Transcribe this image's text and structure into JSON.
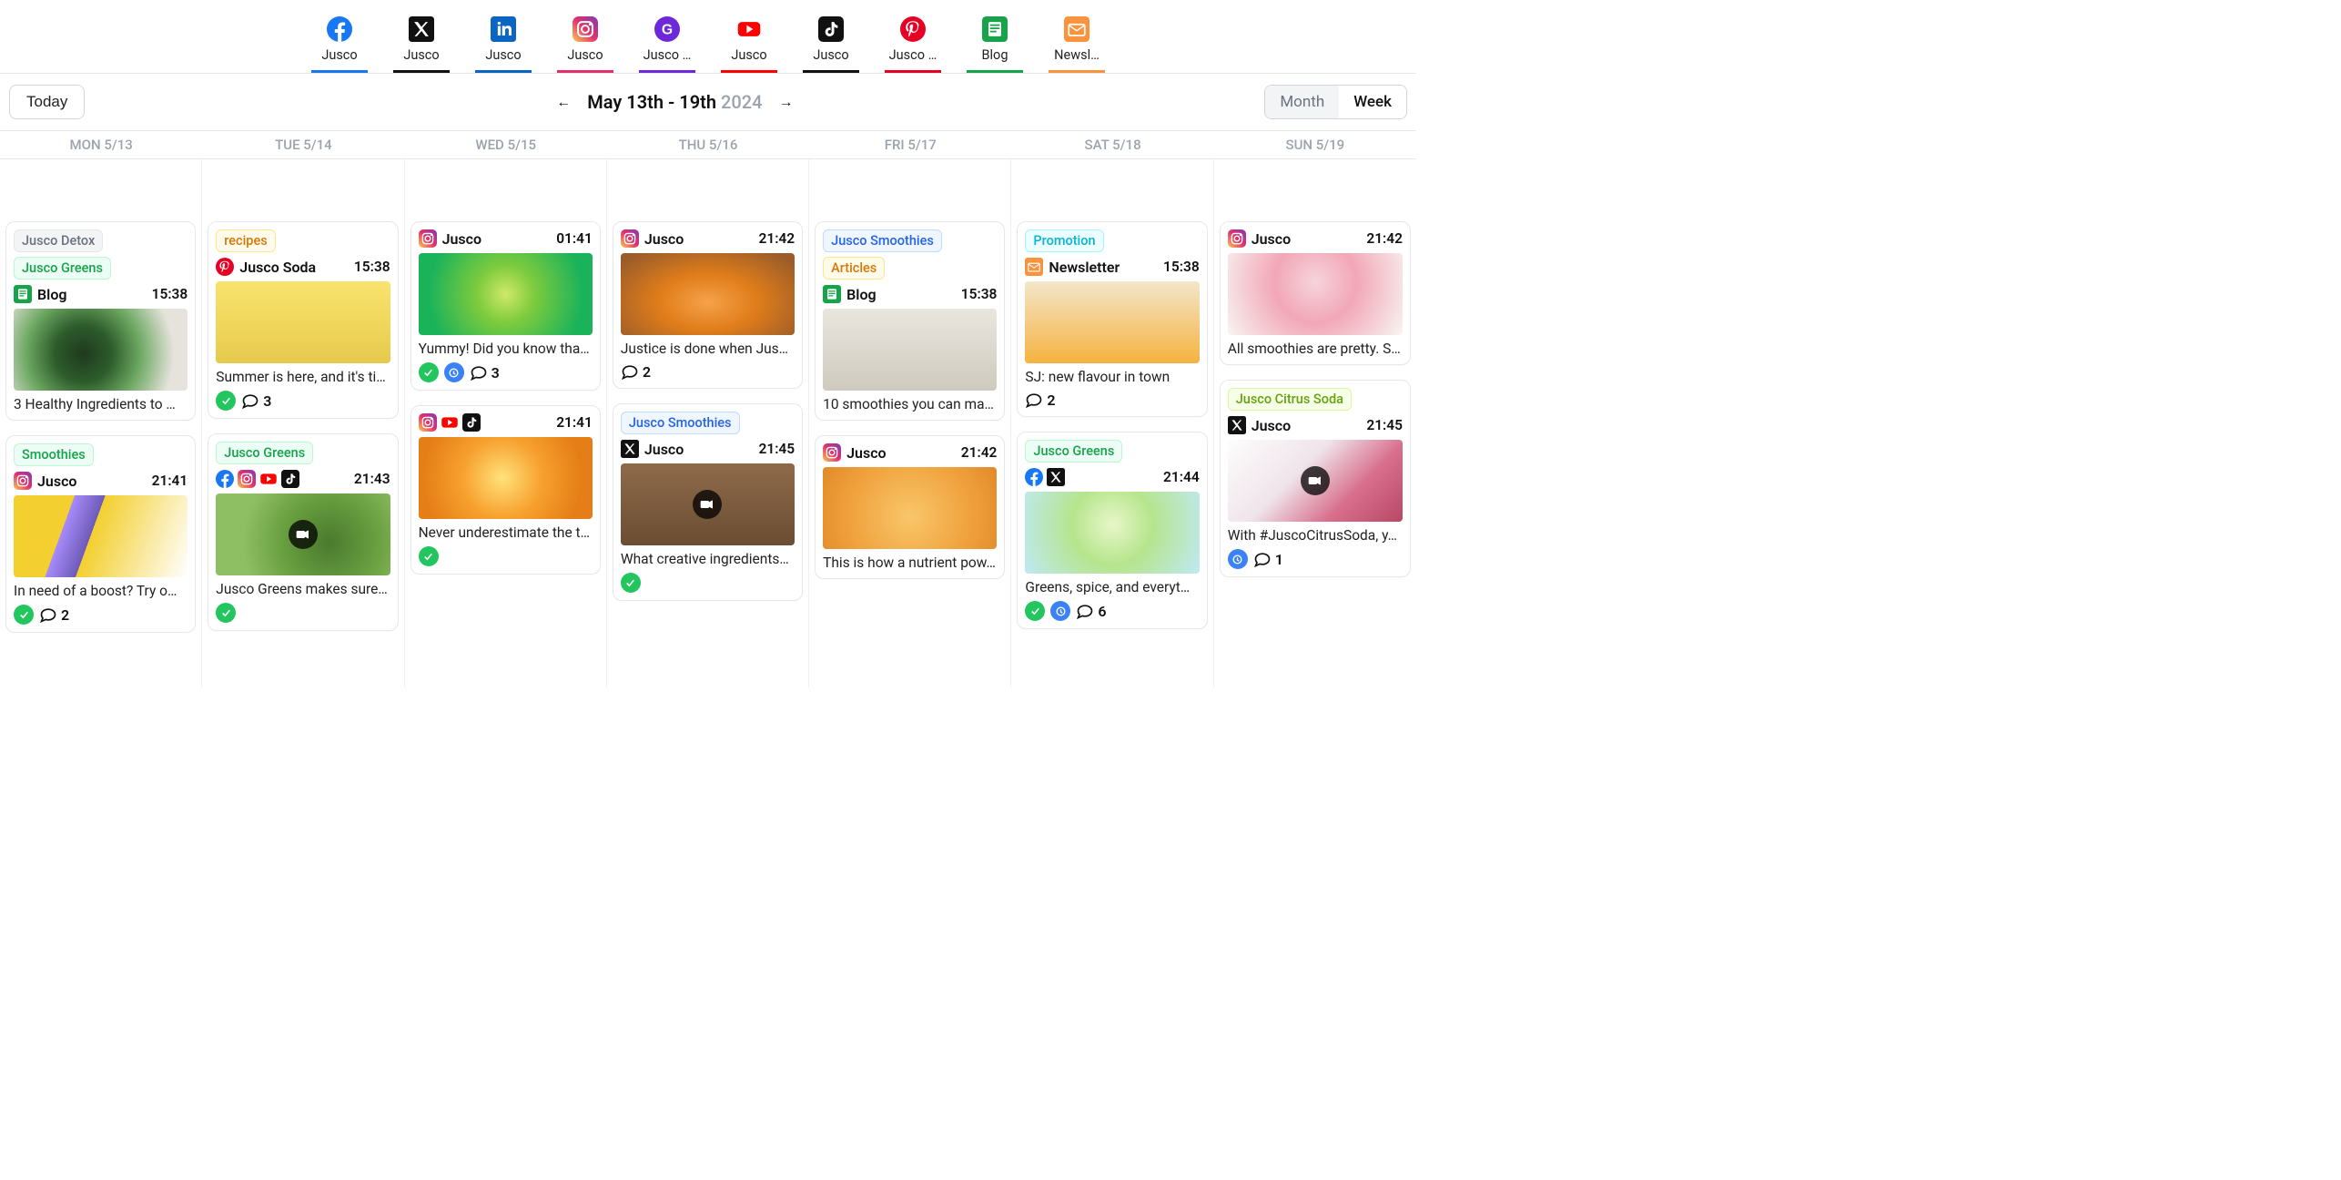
{
  "channels": [
    {
      "label": "Jusco",
      "net": "facebook",
      "bar": "#1877F2"
    },
    {
      "label": "Jusco",
      "net": "x",
      "bar": "#111111"
    },
    {
      "label": "Jusco",
      "net": "linkedin",
      "bar": "#0A66C2"
    },
    {
      "label": "Jusco",
      "net": "instagram",
      "bar": "#E1306C"
    },
    {
      "label": "Jusco …",
      "net": "google",
      "bar": "#6D28D9"
    },
    {
      "label": "Jusco",
      "net": "youtube",
      "bar": "#FF0000"
    },
    {
      "label": "Jusco",
      "net": "tiktok",
      "bar": "#111111"
    },
    {
      "label": "Jusco …",
      "net": "pinterest",
      "bar": "#E60023"
    },
    {
      "label": "Blog",
      "net": "blog",
      "bar": "#16A34A"
    },
    {
      "label": "Newsl…",
      "net": "newsletter",
      "bar": "#FB923C"
    }
  ],
  "toolbar": {
    "today": "Today",
    "range_bold": "May 13th - 19th",
    "range_year": "2024",
    "month": "Month",
    "week": "Week"
  },
  "day_headers": [
    "MON 5/13",
    "TUE 5/14",
    "WED 5/15",
    "THU 5/16",
    "FRI 5/17",
    "SAT 5/18",
    "SUN 5/19"
  ],
  "tag_styles": {
    "Jusco Detox": {
      "bg": "#f3f4f6",
      "fg": "#6b7280",
      "bd": "#e5e7eb"
    },
    "Jusco Greens": {
      "bg": "#ecfdf5",
      "fg": "#16a34a",
      "bd": "#bbf7d0"
    },
    "Smoothies": {
      "bg": "#ecfdf5",
      "fg": "#16a34a",
      "bd": "#bbf7d0"
    },
    "recipes": {
      "bg": "#fffbeb",
      "fg": "#d97706",
      "bd": "#fde68a"
    },
    "Jusco Smoothies": {
      "bg": "#eff6ff",
      "fg": "#2563eb",
      "bd": "#bfdbfe"
    },
    "Articles": {
      "bg": "#fffbeb",
      "fg": "#d97706",
      "bd": "#fde68a"
    },
    "Promotion": {
      "bg": "#ecfeff",
      "fg": "#06b6d4",
      "bd": "#a5f3fc"
    },
    "Jusco Citrus Soda": {
      "bg": "#f7fee7",
      "fg": "#65a30d",
      "bd": "#d9f99d"
    }
  },
  "columns": [
    [
      {
        "tags": [
          "Jusco Detox",
          "Jusco Greens"
        ],
        "nets": [
          "blog"
        ],
        "acct": "Blog",
        "time": "15:38",
        "thumb": "thumb-1",
        "caption": "3 Healthy Ingredients to …"
      },
      {
        "tags": [
          "Smoothies"
        ],
        "nets": [
          "instagram"
        ],
        "acct": "Jusco",
        "time": "21:41",
        "thumb": "thumb-2",
        "caption": "In need of a boost? Try o…",
        "approved": true,
        "comments": 2
      }
    ],
    [
      {
        "tags": [
          "recipes"
        ],
        "nets": [
          "pinterest"
        ],
        "acct": "Jusco Soda",
        "time": "15:38",
        "thumb": "thumb-3",
        "caption": "Summer is here, and it's ti…",
        "approved": true,
        "comments": 3
      },
      {
        "tags": [
          "Jusco Greens"
        ],
        "nets": [
          "facebook",
          "instagram",
          "youtube",
          "tiktok"
        ],
        "acct": "",
        "time": "21:43",
        "thumb": "thumb-4",
        "video": true,
        "caption": "Jusco Greens makes sure…",
        "approved": true
      }
    ],
    [
      {
        "tags": [],
        "nets": [
          "instagram"
        ],
        "acct": "Jusco",
        "time": "01:41",
        "thumb": "thumb-5",
        "caption": "Yummy! Did you know tha…",
        "approved": true,
        "clock": true,
        "comments": 3
      },
      {
        "tags": [],
        "nets": [
          "instagram",
          "youtube",
          "tiktok"
        ],
        "acct": "",
        "time": "21:41",
        "thumb": "thumb-6",
        "caption": "Never underestimate the t…",
        "approved": true
      }
    ],
    [
      {
        "tags": [],
        "nets": [
          "instagram"
        ],
        "acct": "Jusco",
        "time": "21:42",
        "thumb": "thumb-7",
        "caption": "Justice is done when Jus…",
        "comments": 2
      },
      {
        "tags": [
          "Jusco Smoothies"
        ],
        "nets": [
          "x"
        ],
        "acct": "Jusco",
        "time": "21:45",
        "thumb": "thumb-8",
        "video": true,
        "caption": "What creative ingredients…",
        "approved": true
      }
    ],
    [
      {
        "tags": [
          "Jusco Smoothies",
          "Articles"
        ],
        "nets": [
          "blog"
        ],
        "acct": "Blog",
        "time": "15:38",
        "thumb": "thumb-9",
        "caption": "10 smoothies you can ma…"
      },
      {
        "tags": [],
        "nets": [
          "instagram"
        ],
        "acct": "Jusco",
        "time": "21:42",
        "thumb": "thumb-10",
        "caption": "This is how a nutrient pow…"
      }
    ],
    [
      {
        "tags": [
          "Promotion"
        ],
        "nets": [
          "newsletter"
        ],
        "acct": "Newsletter",
        "time": "15:38",
        "thumb": "thumb-11",
        "caption": "SJ: new flavour in town",
        "comments": 2
      },
      {
        "tags": [
          "Jusco Greens"
        ],
        "nets": [
          "facebook",
          "x"
        ],
        "acct": "",
        "time": "21:44",
        "thumb": "thumb-12",
        "caption": "Greens, spice, and everyt…",
        "approved": true,
        "clock": true,
        "comments": 6
      }
    ],
    [
      {
        "tags": [],
        "nets": [
          "instagram"
        ],
        "acct": "Jusco",
        "time": "21:42",
        "thumb": "thumb-13",
        "caption": "All smoothies are pretty. S…"
      },
      {
        "tags": [
          "Jusco Citrus Soda"
        ],
        "nets": [
          "x"
        ],
        "acct": "Jusco",
        "time": "21:45",
        "thumb": "thumb-14",
        "video": true,
        "caption": "With #JuscoCitrusSoda, y…",
        "clock": true,
        "comments": 1
      }
    ]
  ]
}
